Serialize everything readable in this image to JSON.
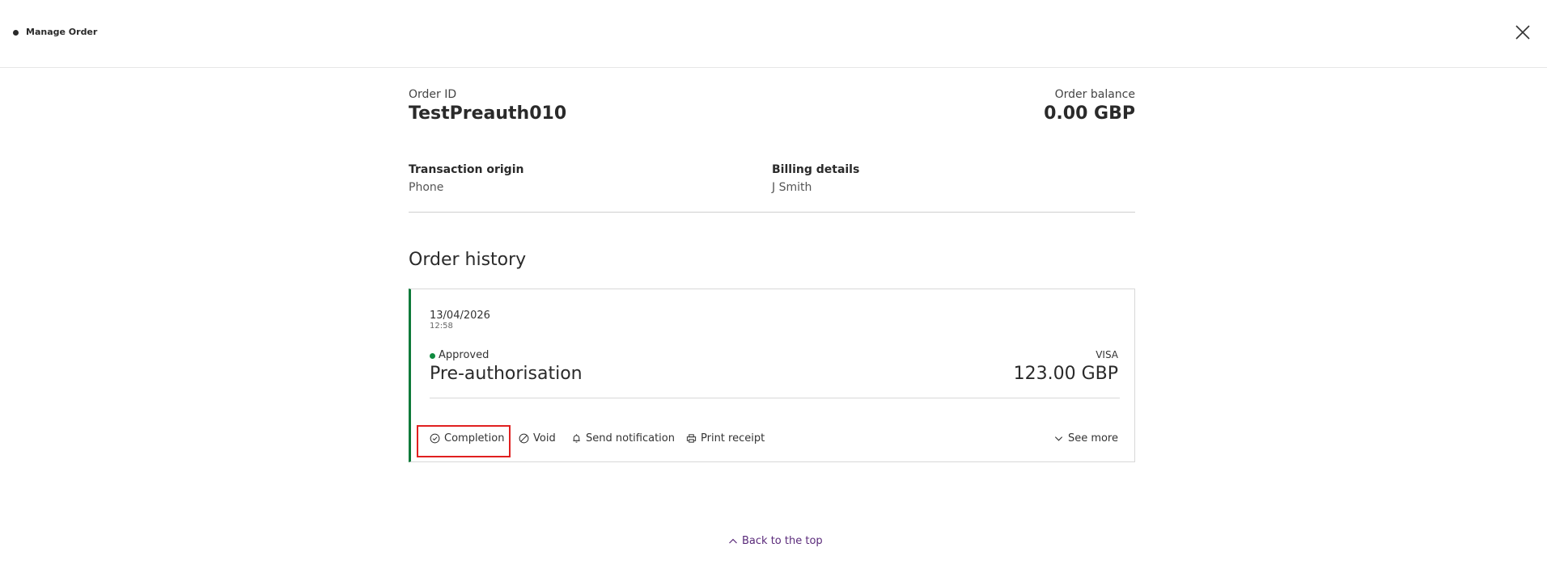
{
  "header": {
    "title": "Manage Order"
  },
  "order": {
    "id_label": "Order ID",
    "id": "TestPreauth010",
    "balance_label": "Order balance",
    "balance": "0.00 GBP",
    "origin_label": "Transaction origin",
    "origin": "Phone",
    "billing_label": "Billing details",
    "billing": "J Smith"
  },
  "history": {
    "title": "Order history",
    "entries": [
      {
        "date": "13/04/2026",
        "time": "12:58",
        "status": "Approved",
        "type": "Pre-authorisation",
        "card_brand": "VISA",
        "amount": "123.00 GBP",
        "actions": {
          "completion": "Completion",
          "void": "Void",
          "send_notification": "Send notification",
          "print_receipt": "Print receipt",
          "see_more": "See more"
        }
      }
    ]
  },
  "footer": {
    "back_to_top": "Back to the top"
  },
  "colors": {
    "accent_green": "#0f7a3a",
    "link_purple": "#5a2a7a",
    "highlight_red": "#e02020"
  },
  "icons": {
    "completion": "check-circle-icon",
    "void": "prohibited-icon",
    "notify": "bell-icon",
    "print": "printer-icon",
    "see_more": "chevron-down-icon",
    "back_to_top": "chevron-up-icon",
    "close": "close-icon"
  }
}
